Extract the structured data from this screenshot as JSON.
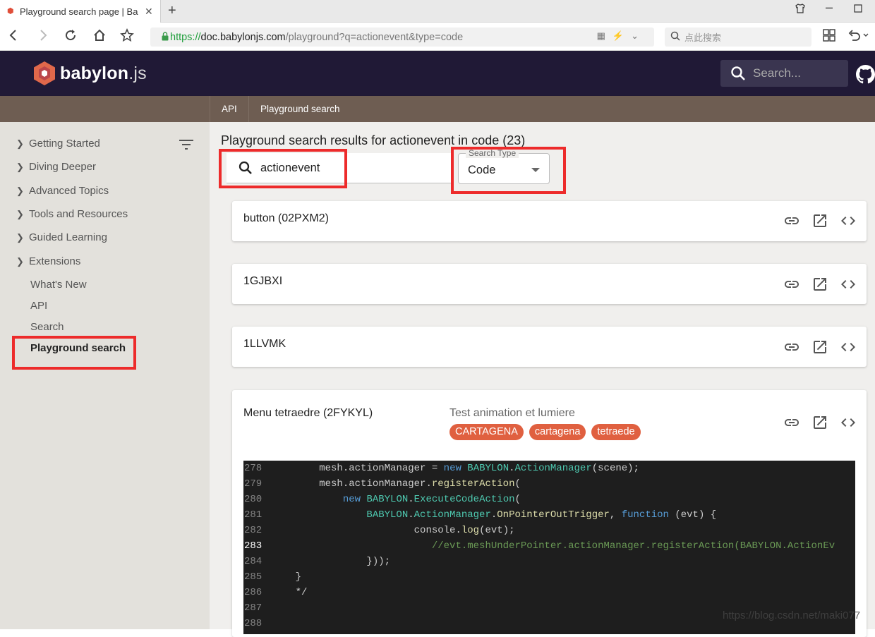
{
  "browser": {
    "tab_title": "Playground search page | Ba",
    "url_scheme": "https://",
    "url_host": "doc.babylonjs.com",
    "url_rest": "/playground?q=actionevent&type=code",
    "search_placeholder": "点此搜索"
  },
  "site": {
    "logo_main": "babylon",
    "logo_ext": ".js",
    "search_placeholder": "Search...",
    "colors": {
      "header": "#201936",
      "breadcrumb_bar": "#6e5d52",
      "tag": "#e06040",
      "highlight": "#ed2b2b"
    }
  },
  "breadcrumb": [
    "API",
    "Playground search"
  ],
  "sidebar": {
    "sections": [
      "Getting Started",
      "Diving Deeper",
      "Advanced Topics",
      "Tools and Resources",
      "Guided Learning",
      "Extensions"
    ],
    "links": [
      "What's New",
      "API",
      "Search",
      "Playground search"
    ]
  },
  "main": {
    "title": "Playground search results for actionevent in code (23)",
    "query": "actionevent",
    "search_type_label": "Search Type",
    "search_type_value": "Code"
  },
  "results": [
    {
      "title": "button (02PXM2)"
    },
    {
      "title": "1GJBXI"
    },
    {
      "title": "1LLVMK"
    },
    {
      "title": "Menu tetraedre (2FYKYL)",
      "description": "Test animation et lumiere",
      "tags": [
        "CARTAGENA",
        "cartagena",
        "tetraede"
      ]
    }
  ],
  "code": {
    "line_numbers": [
      "278",
      "279",
      "280",
      "281",
      "282",
      "283",
      "284",
      "285",
      "286",
      "287",
      "288"
    ],
    "current_line": "283",
    "lines": [
      "        mesh.actionManager = new BABYLON.ActionManager(scene);",
      "        mesh.actionManager.registerAction(",
      "            new BABYLON.ExecuteCodeAction(",
      "                BABYLON.ActionManager.OnPointerOutTrigger, function (evt) {",
      "                        console.log(evt);",
      "                           //evt.meshUnderPointer.actionManager.registerAction(BABYLON.ActionEv",
      "                }));",
      "    }",
      "    */",
      "",
      ""
    ]
  },
  "watermark": "https://blog.csdn.net/maki077"
}
